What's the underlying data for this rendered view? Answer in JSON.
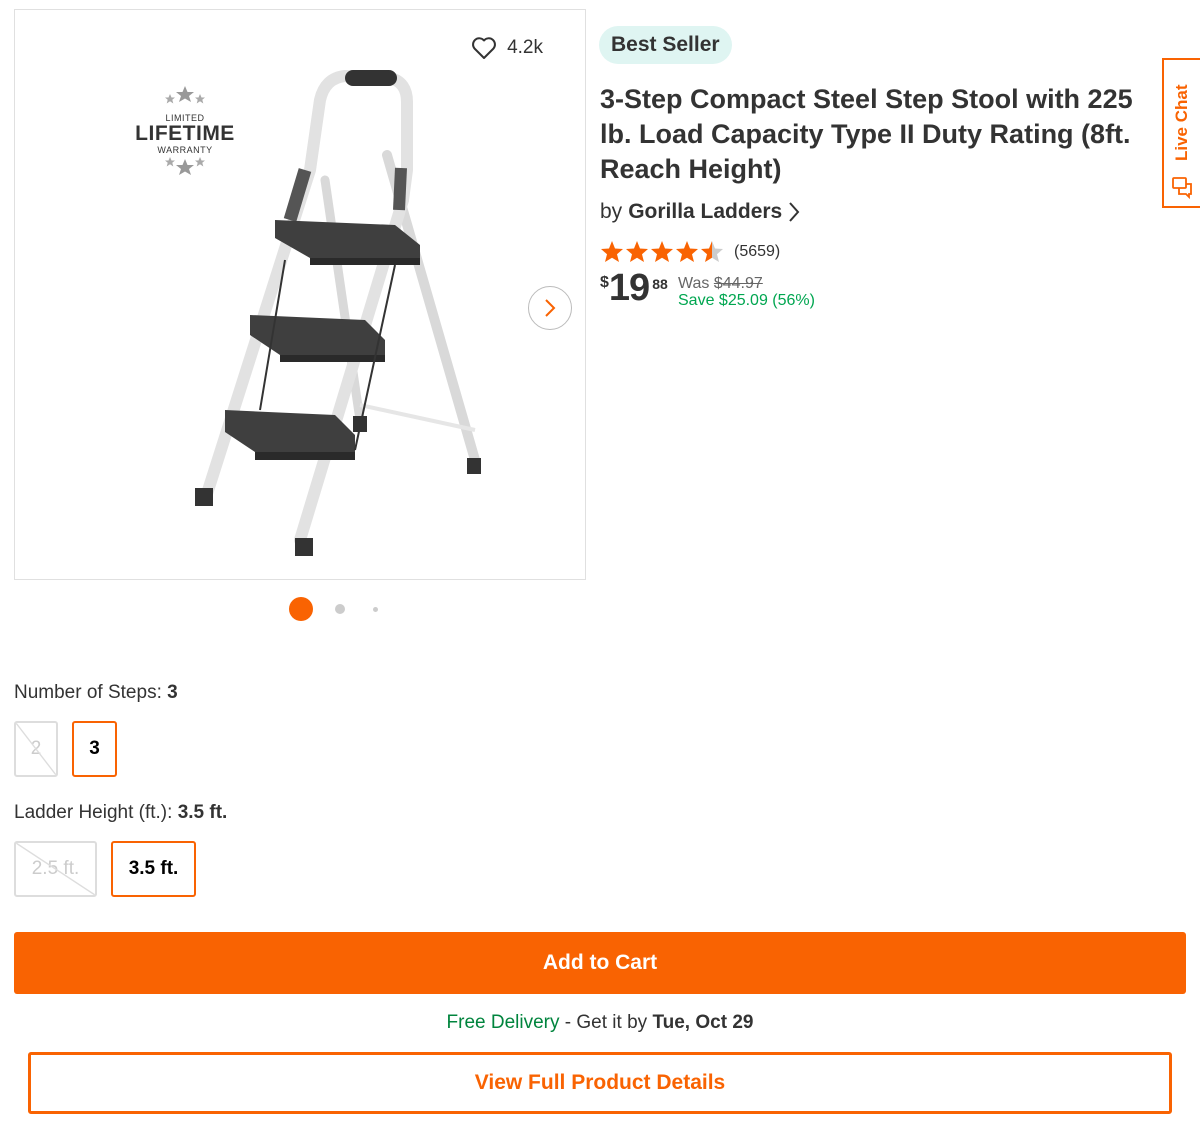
{
  "gallery": {
    "favorites_count": "4.2k",
    "warranty": {
      "line1": "LIMITED",
      "line2": "LIFETIME",
      "line3": "WARRANTY"
    }
  },
  "badge": "Best Seller",
  "product": {
    "title": "3-Step Compact Steel Step Stool with 225 lb. Load Capacity Type II Duty Rating (8ft. Reach Height)",
    "brand_prefix": "by",
    "brand": "Gorilla Ladders",
    "rating_value": 4.5,
    "review_count": "(5659)",
    "price": {
      "currency": "$",
      "whole": "19",
      "cents": "88"
    },
    "was_label": "Was",
    "was_price": "$44.97",
    "savings": "Save $25.09 (56%)"
  },
  "live_chat": {
    "label": "Live Chat"
  },
  "options": {
    "steps": {
      "label": "Number of Steps: ",
      "selected": "3",
      "choices": [
        {
          "value": "2",
          "state": "disabled"
        },
        {
          "value": "3",
          "state": "selected"
        }
      ]
    },
    "height": {
      "label": "Ladder Height (ft.): ",
      "selected": "3.5 ft.",
      "choices": [
        {
          "value": "2.5 ft.",
          "state": "disabled"
        },
        {
          "value": "3.5 ft.",
          "state": "selected"
        }
      ]
    }
  },
  "cart": {
    "add_label": "Add to Cart"
  },
  "delivery": {
    "free": "Free Delivery",
    "middle": " - Get it by ",
    "date": "Tue, Oct 29"
  },
  "details": {
    "label": "View Full Product Details"
  },
  "colors": {
    "brand_orange": "#f96302",
    "save_green": "#00a650",
    "delivery_green": "#00843d",
    "badge_bg": "#dff5f2"
  }
}
